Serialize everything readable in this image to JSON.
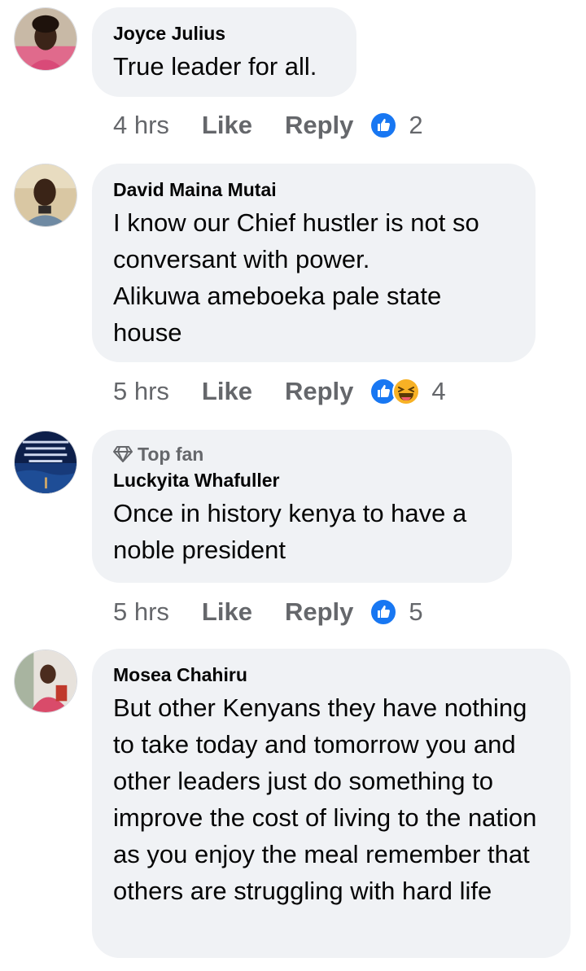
{
  "comments": [
    {
      "author": "Joyce Julius",
      "top_fan": "",
      "body": "True leader for all.",
      "time": "4 hrs",
      "like_label": "Like",
      "reply_label": "Reply",
      "reactions": [
        "like"
      ],
      "reaction_count": "2"
    },
    {
      "author": "David Maina Mutai",
      "top_fan": "",
      "body": "I know our Chief hustler is not so conversant with power.\nAlikuwa ameboeka pale state house",
      "time": "5 hrs",
      "like_label": "Like",
      "reply_label": "Reply",
      "reactions": [
        "like",
        "haha"
      ],
      "reaction_count": "4"
    },
    {
      "author": "Luckyita Whafuller",
      "top_fan": "Top fan",
      "body": "Once in history kenya to have a noble president",
      "time": "5 hrs",
      "like_label": "Like",
      "reply_label": "Reply",
      "reactions": [
        "like"
      ],
      "reaction_count": "5"
    },
    {
      "author": "Mosea Chahiru",
      "top_fan": "",
      "body": "But other Kenyans they have nothing to take today and tomorrow you and other leaders just do something to improve the cost of living to the nation as you enjoy the meal remember that others are struggling with hard life",
      "time": "",
      "like_label": "",
      "reply_label": "",
      "reactions": [],
      "reaction_count": ""
    }
  ],
  "colors": {
    "bubble": "#f0f2f5",
    "meta_text": "#65676b",
    "like_blue": "#1877f2",
    "haha_yellow": "#f7b125"
  },
  "icons": {
    "like": "thumbs-up-icon",
    "haha": "laughing-face-icon",
    "top_fan": "diamond-icon"
  }
}
